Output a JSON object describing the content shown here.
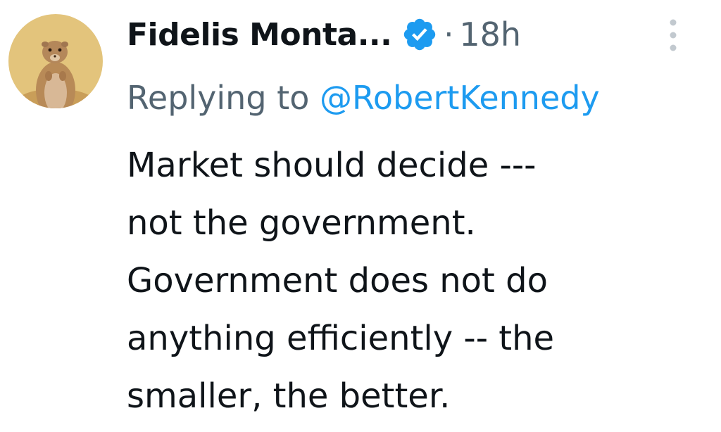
{
  "tweet": {
    "author_name": "Fidelis Monta...",
    "separator": "·",
    "time": "18h",
    "replying_prefix": "Replying to",
    "replying_handle": "@RobertKennedy",
    "text_lines": [
      "Market should decide ---",
      "not the government.",
      "Government does not do",
      "anything efficiently -- the",
      "smaller, the better."
    ]
  },
  "icons": {
    "avatar": "prairie-dog-avatar",
    "verified": "verified-badge-icon",
    "more": "more-options-icon"
  },
  "colors": {
    "name": "#0f1419",
    "secondary": "#536471",
    "accent": "#1d9bf0",
    "background": "#ffffff"
  }
}
